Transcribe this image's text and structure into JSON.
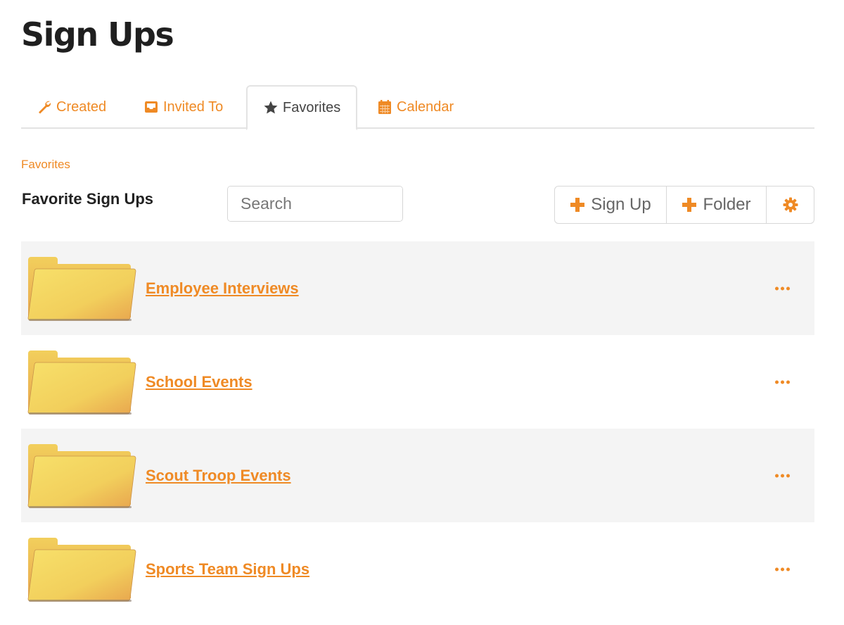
{
  "page": {
    "title": "Sign Ups"
  },
  "tabs": [
    {
      "label": "Created",
      "icon": "wrench-icon",
      "active": false
    },
    {
      "label": "Invited To",
      "icon": "inbox-icon",
      "active": false
    },
    {
      "label": "Favorites",
      "icon": "star-icon",
      "active": true
    },
    {
      "label": "Calendar",
      "icon": "calendar-icon",
      "active": false
    }
  ],
  "breadcrumb": {
    "label": "Favorites"
  },
  "section": {
    "title": "Favorite Sign Ups"
  },
  "search": {
    "placeholder": "Search",
    "value": ""
  },
  "toolbar": {
    "signup_label": "Sign Up",
    "folder_label": "Folder",
    "settings_icon": "gear-icon"
  },
  "folders": [
    {
      "name": "Employee Interviews"
    },
    {
      "name": "School Events"
    },
    {
      "name": "Scout Troop Events"
    },
    {
      "name": "Sports Team Sign Ups"
    }
  ],
  "colors": {
    "accent": "#ef8a25",
    "row_alt": "#f4f4f4",
    "border": "#e3e3e3"
  }
}
